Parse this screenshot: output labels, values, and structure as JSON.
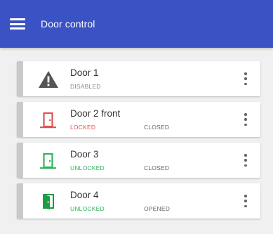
{
  "appbar": {
    "title": "Door control",
    "menu_icon": "hamburger-menu-icon",
    "color": "#3b52c4"
  },
  "doors": [
    {
      "name": "Door 1",
      "lock_status": "DISABLED",
      "door_state": "",
      "icon": "warning-triangle-icon",
      "status_color": "#8a8a8a"
    },
    {
      "name": "Door 2 front",
      "lock_status": "LOCKED",
      "door_state": "CLOSED",
      "icon": "door-closed-icon",
      "status_color": "#e05252"
    },
    {
      "name": "Door 3",
      "lock_status": "UNLOCKED",
      "door_state": "CLOSED",
      "icon": "door-closed-icon",
      "status_color": "#2fb35a"
    },
    {
      "name": "Door 4",
      "lock_status": "UNLOCKED",
      "door_state": "OPENED",
      "icon": "door-open-icon",
      "status_color": "#1f9a47"
    }
  ]
}
